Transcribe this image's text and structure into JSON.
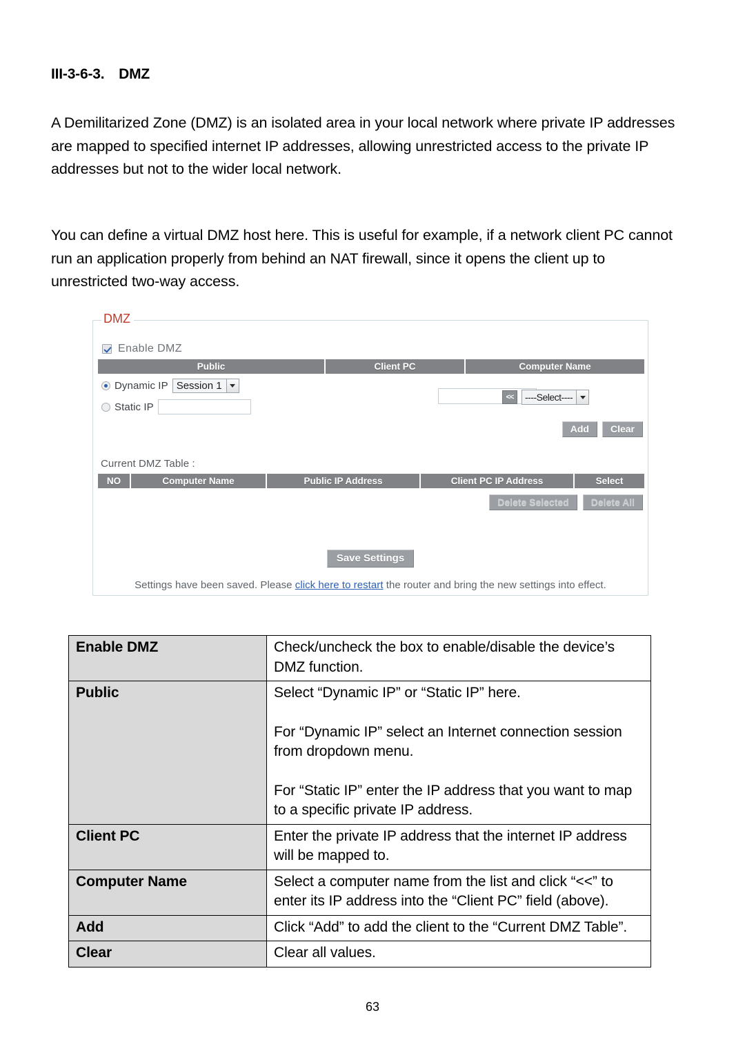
{
  "document": {
    "heading": "III-3-6-3. DMZ",
    "paragraphs": [
      "A Demilitarized Zone (DMZ) is an isolated area in your local network where private IP addresses are mapped to specified internet IP addresses, allowing unrestricted access to the private IP addresses but not to the wider local network.",
      "You can define a virtual DMZ host here. This is useful for example, if a network client PC cannot run an application properly from behind an NAT firewall, since it opens the client up to unrestricted two-way access."
    ],
    "page_number": "63"
  },
  "screenshot": {
    "legend": "DMZ",
    "legend_color": "#c0392b",
    "header_bar_color": "#808285",
    "enable_checkbox": {
      "label": "Enable  DMZ",
      "checked": true
    },
    "columns": [
      "Public",
      "Client PC",
      "Computer Name"
    ],
    "public": {
      "dynamic_ip_label": "Dynamic IP",
      "dynamic_ip_selected": true,
      "session_select_value": "Session  1",
      "static_ip_label": "Static IP",
      "static_ip_selected": false,
      "static_ip_value": ""
    },
    "client_pc": {
      "value": ""
    },
    "computer_name": {
      "arrow_button_label": "<<",
      "select_value": "----Select----"
    },
    "form_buttons": {
      "add": "Add",
      "clear": "Clear"
    },
    "current_table": {
      "label": "Current DMZ Table :",
      "columns": [
        "NO",
        "Computer Name",
        "Public  IP Address",
        "Client PC  IP Address",
        "Select"
      ],
      "rows": [],
      "delete_selected": "Delete Selected",
      "delete_all": "Delete All"
    },
    "save_button": "Save Settings",
    "status": {
      "prefix": "Settings have been saved. Please ",
      "link": "click here to restart",
      "suffix": " the router and bring the new settings into effect."
    }
  },
  "description_table": {
    "rows": [
      {
        "key": "Enable DMZ",
        "paragraphs": [
          "Check/uncheck the box to enable/disable the device’s DMZ function."
        ]
      },
      {
        "key": "Public",
        "paragraphs": [
          "Select “Dynamic IP” or “Static IP” here.",
          "For “Dynamic IP” select an Internet connection session from dropdown menu.",
          "For “Static IP” enter the IP address that you want to map to a specific private IP address."
        ]
      },
      {
        "key": "Client PC",
        "paragraphs": [
          "Enter the private IP address that the internet IP address will be mapped to."
        ]
      },
      {
        "key": "Computer Name",
        "paragraphs": [
          "Select a computer name from the list and click “<<” to enter its IP address into the “Client PC” field (above)."
        ]
      },
      {
        "key": "Add",
        "paragraphs": [
          "Click “Add” to add the client to the “Current DMZ Table”."
        ]
      },
      {
        "key": "Clear",
        "paragraphs": [
          "Clear all values."
        ]
      }
    ]
  }
}
